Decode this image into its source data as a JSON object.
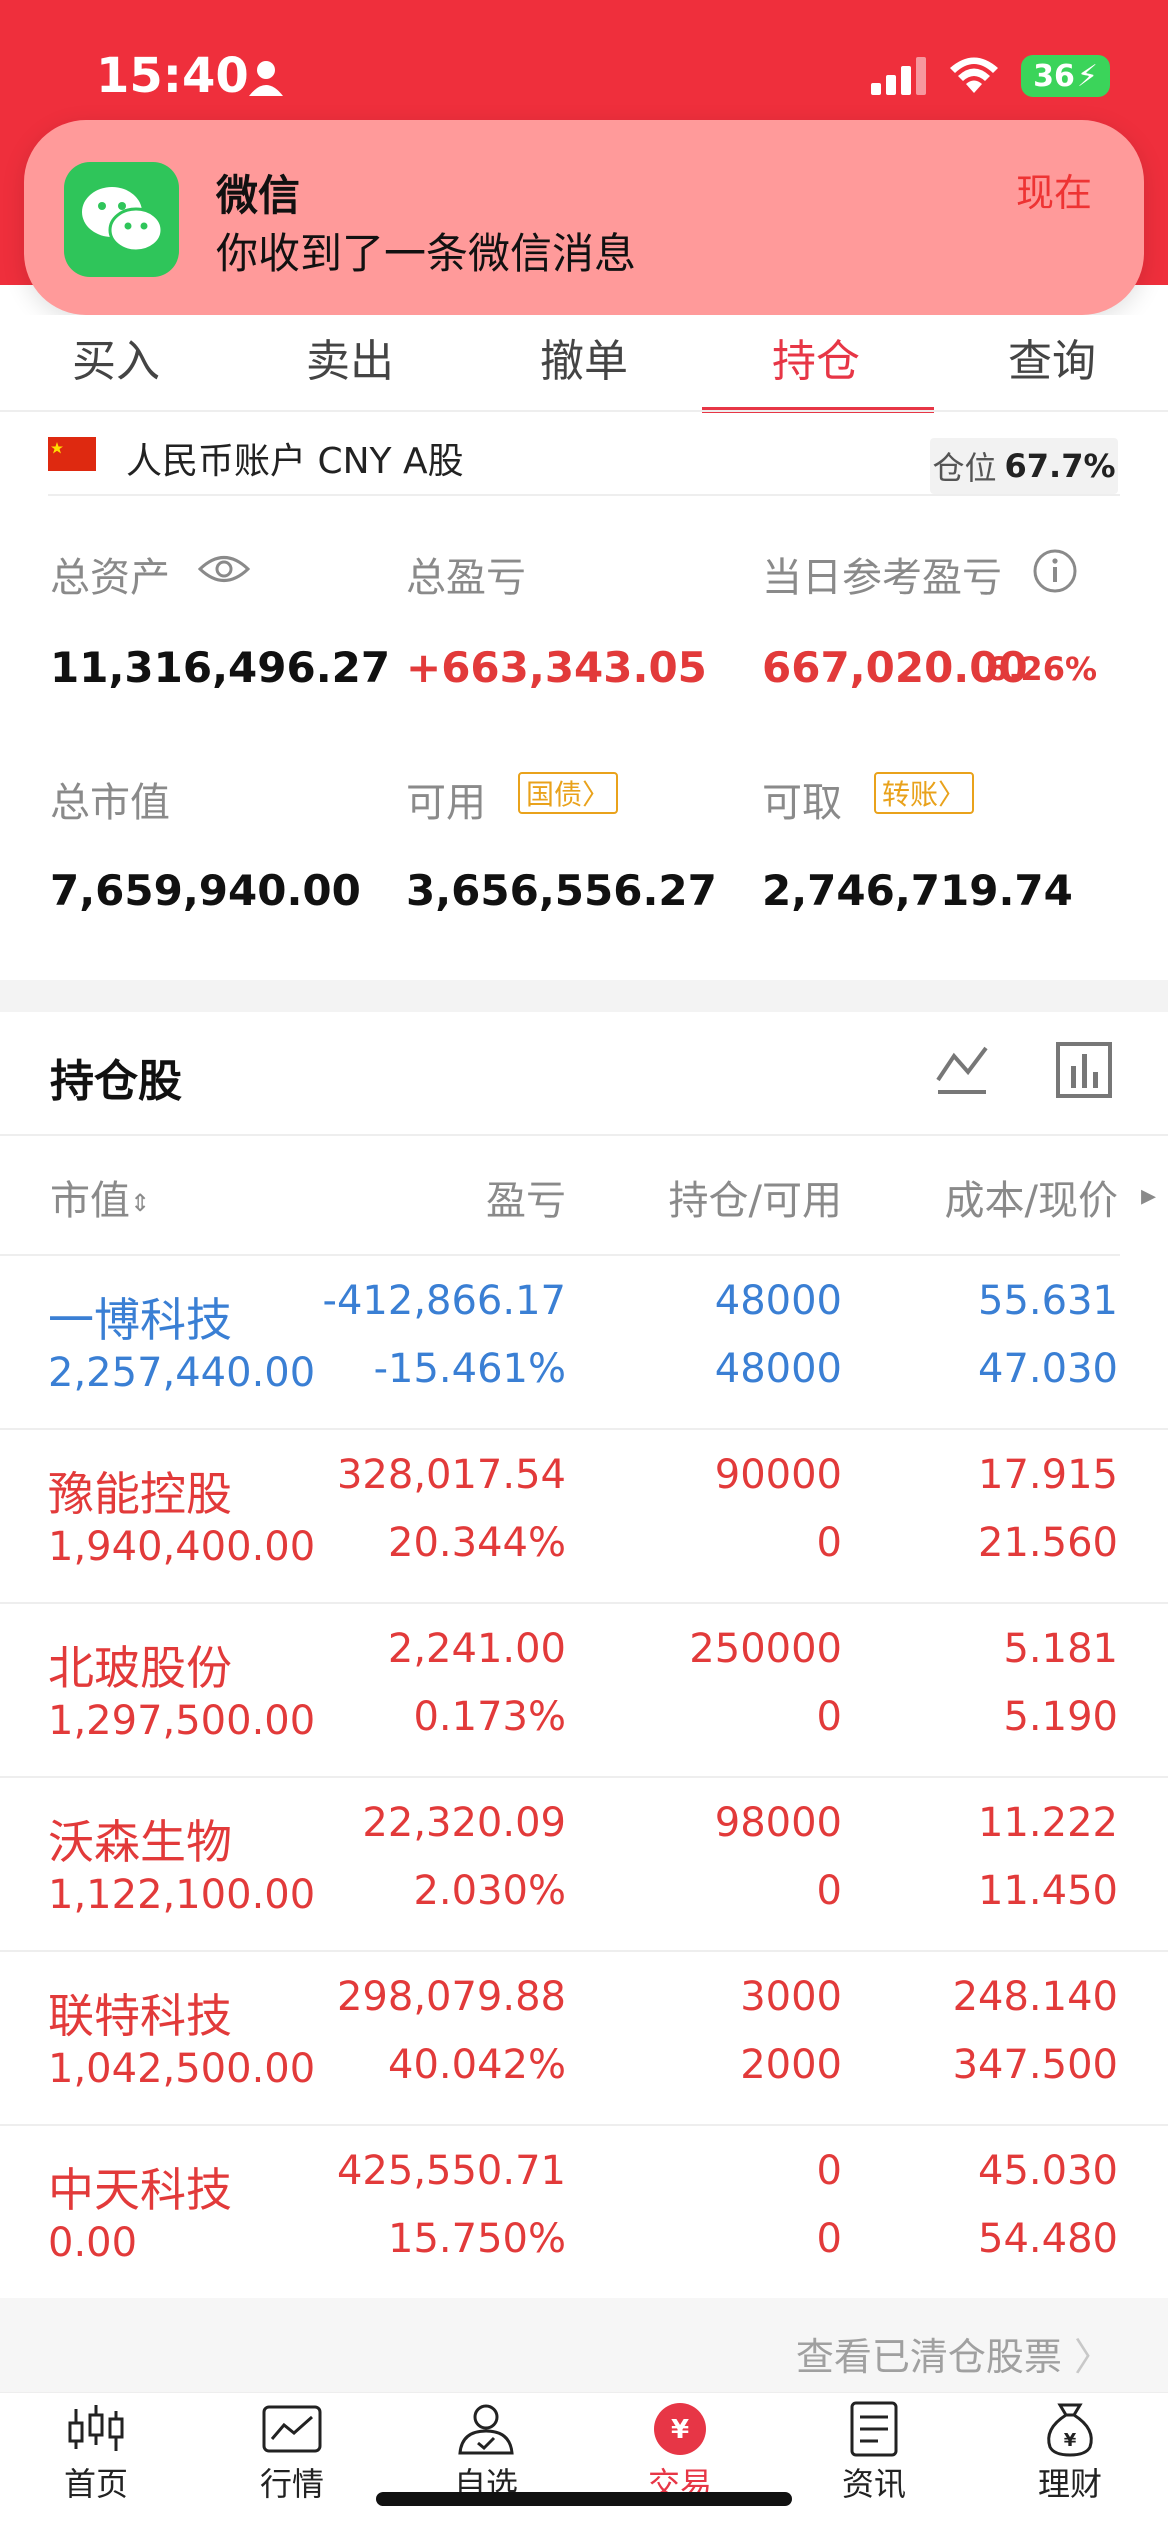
{
  "status_bar": {
    "time": "15:40",
    "battery": "36"
  },
  "notification": {
    "app": "微信",
    "message": "你收到了一条微信消息",
    "time": "现在"
  },
  "tabs": [
    {
      "label": "买入"
    },
    {
      "label": "卖出"
    },
    {
      "label": "撤单"
    },
    {
      "label": "持仓",
      "active": true
    },
    {
      "label": "查询"
    }
  ],
  "account": {
    "label": "人民币账户 CNY A股",
    "position_label": "仓位",
    "position_value": "67.7%"
  },
  "summary": {
    "total_assets_label": "总资产",
    "total_assets": "11,316,496.27",
    "total_pl_label": "总盈亏",
    "total_pl": "+663,343.05",
    "daily_pl_label": "当日参考盈亏",
    "daily_pl": "667,020.00",
    "daily_pl_pct": "6.26%",
    "market_value_label": "总市值",
    "market_value": "7,659,940.00",
    "available_label": "可用",
    "available_tag": "国债",
    "available": "3,656,556.27",
    "withdrawable_label": "可取",
    "withdrawable_tag": "转账",
    "withdrawable": "2,746,719.74"
  },
  "holdings": {
    "title": "持仓股",
    "columns": {
      "market_value": "市值",
      "pl": "盈亏",
      "hold": "持仓/可用",
      "cost": "成本/现价"
    },
    "rows": [
      {
        "name": "一博科技",
        "market_value": "2,257,440.00",
        "pl": "-412,866.17",
        "pl_pct": "-15.461%",
        "hold": "48000",
        "avail": "48000",
        "cost": "55.631",
        "price": "47.030"
      },
      {
        "name": "豫能控股",
        "market_value": "1,940,400.00",
        "pl": "328,017.54",
        "pl_pct": "20.344%",
        "hold": "90000",
        "avail": "0",
        "cost": "17.915",
        "price": "21.560"
      },
      {
        "name": "北玻股份",
        "market_value": "1,297,500.00",
        "pl": "2,241.00",
        "pl_pct": "0.173%",
        "hold": "250000",
        "avail": "0",
        "cost": "5.181",
        "price": "5.190"
      },
      {
        "name": "沃森生物",
        "market_value": "1,122,100.00",
        "pl": "22,320.09",
        "pl_pct": "2.030%",
        "hold": "98000",
        "avail": "0",
        "cost": "11.222",
        "price": "11.450"
      },
      {
        "name": "联特科技",
        "market_value": "1,042,500.00",
        "pl": "298,079.88",
        "pl_pct": "40.042%",
        "hold": "3000",
        "avail": "2000",
        "cost": "248.140",
        "price": "347.500"
      },
      {
        "name": "中天科技",
        "market_value": "0.00",
        "pl": "425,550.71",
        "pl_pct": "15.750%",
        "hold": "0",
        "avail": "0",
        "cost": "45.030",
        "price": "54.480"
      }
    ],
    "cleared_link": "查看已清仓股票"
  },
  "nav": [
    {
      "label": "首页"
    },
    {
      "label": "行情"
    },
    {
      "label": "自选"
    },
    {
      "label": "交易",
      "active": true
    },
    {
      "label": "资讯"
    },
    {
      "label": "理财"
    }
  ],
  "colors": {
    "brand_red": "#ef2f3c",
    "loss_blue": "#3a7fd4",
    "gain_red": "#e23a3a",
    "tag_orange": "#e9a21b"
  }
}
